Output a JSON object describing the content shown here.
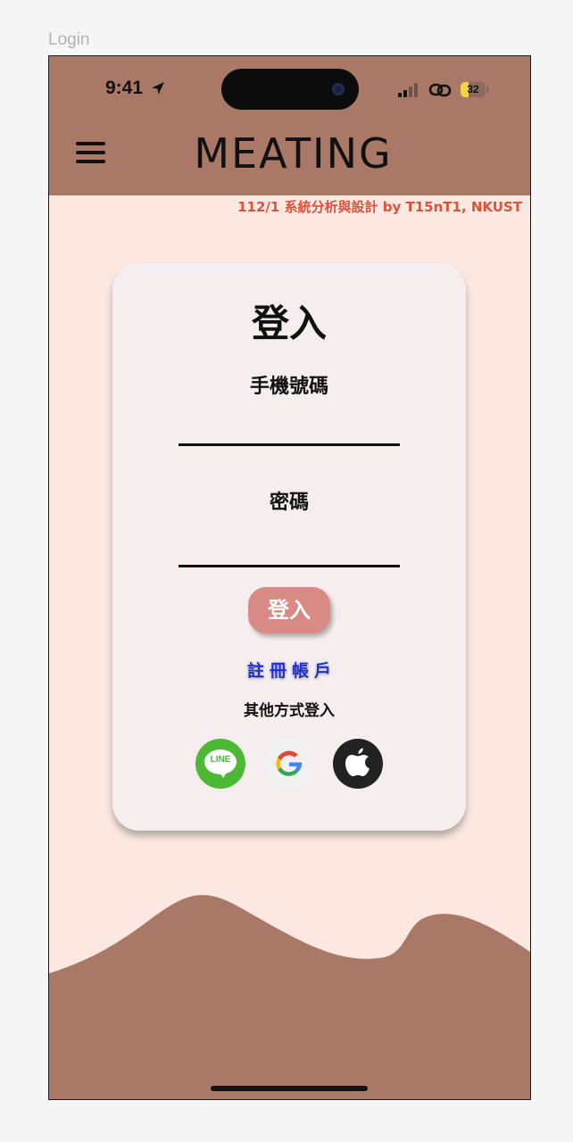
{
  "frame_label": "Login",
  "status_bar": {
    "time": "9:41",
    "battery_level": "32",
    "battery_fraction": 0.32,
    "icons": [
      "location-arrow-icon",
      "signal-icon",
      "link-icon",
      "battery-icon"
    ]
  },
  "header": {
    "app_title": "MEATING",
    "menu_icon": "hamburger-menu-icon"
  },
  "credit": "112/1 系統分析與設計 by T15nT1, NKUST",
  "card": {
    "title": "登入",
    "phone_label": "手機號碼",
    "phone_value": "",
    "password_label": "密碼",
    "password_value": "",
    "login_button": "登入",
    "register_link": "註冊帳戶",
    "other_login_label": "其他方式登入",
    "social_logins": [
      {
        "name": "line",
        "text": "LINE",
        "icon": "line-icon",
        "color": "#4cb836"
      },
      {
        "name": "google",
        "icon": "google-icon"
      },
      {
        "name": "apple",
        "icon": "apple-icon"
      }
    ]
  },
  "colors": {
    "header_bg": "#a97866",
    "page_bg": "#fce8e1",
    "card_bg": "#f6eeee",
    "button_bg": "#d98a84",
    "credit_text": "#d9533d",
    "link_text": "#1f2fd6"
  }
}
